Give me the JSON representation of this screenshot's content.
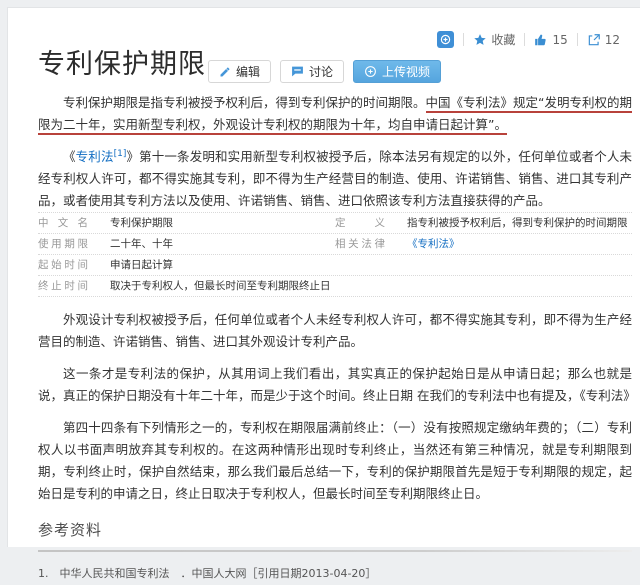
{
  "header": {
    "title": "专利保护期限",
    "buttons": {
      "edit": "编辑",
      "discuss": "讨论",
      "upload_video": "上传视频"
    },
    "actions": {
      "favorite": "收藏",
      "likes": "15",
      "shares": "12"
    }
  },
  "article": {
    "p1": {
      "plain": "专利保护期限是指专利被授予权利后，得到专利保护的时间期限。",
      "marked": "中国《专利法》规定“发明专利权的期限为二十年，实用新型专利权，外观设计专利权的期限为十年，均自申请日起计算”。"
    },
    "p2": {
      "open": "《",
      "link": "专利法",
      "sup": "[1]",
      "rest": "》第十一条发明和实用新型专利权被授予后，除本法另有规定的以外，任何单位或者个人未经专利权人许可，都不得实施其专利，即不得为生产经营目的制造、使用、许诺销售、销售、进口其专利产品，或者使用其专利方法以及使用、许诺销售、销售、进口依照该专利方法直接获得的产品。"
    },
    "p3": "外观设计专利权被授予后，任何单位或者个人未经专利权人许可，都不得实施其专利，即不得为生产经营目的制造、许诺销售、销售、进口其外观设计专利产品。",
    "p4": "这一条才是专利法的保护，从其用词上我们看出，其实真正的保护起始日是从申请日起；那么也就是说，真正的保护日期没有十年二十年，而是少于这个时间。终止日期 在我们的专利法中也有提及，《专利法》",
    "p5": "第四十四条有下列情形之一的，专利权在期限届满前终止：（一）没有按照规定缴纳年费的；（二）专利权人以书面声明放弃其专利权的。在这两种情形出现时专利终止，当然还有第三种情况，就是专利期限到期，专利终止时，保护自然结束，那么我们最后总结一下，专利的保护期限首先是短于专利期限的规定，起始日是专利的申请之日，终止日取决于专利权人，但最长时间至专利期限终止日。"
  },
  "infobox": {
    "rows": [
      {
        "l_label": "中文名",
        "l_value": "专利保护期限",
        "r_label": "定义",
        "r_value": "指专利被授予权利后，得到专利保护的时间期限"
      },
      {
        "l_label": "使用期限",
        "l_value": "二十年、十年",
        "r_label": "相关法律",
        "r_value": "《专利法》"
      },
      {
        "l_label": "起始时间",
        "l_value": "申请日起计算"
      },
      {
        "l_label": "终止时间",
        "l_value": "取决于专利权人，但最长时间至专利期限终止日"
      }
    ]
  },
  "references": {
    "heading": "参考资料",
    "item": "1.　中华人民共和国专利法　．中国人大网［引用日期2013-04-20］"
  },
  "colors": {
    "accent_blue": "#3a8ed2",
    "link_blue": "#136ec2",
    "marker_red": "#b8423b"
  }
}
